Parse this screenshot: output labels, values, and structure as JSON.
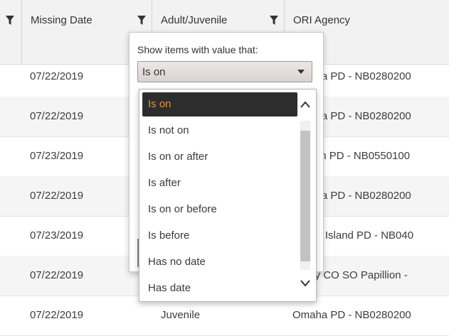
{
  "table": {
    "headers": {
      "missing_date": "Missing Date",
      "adult_juvenile": "Adult/Juvenile",
      "ori_agency": "ORI Agency"
    },
    "rows": [
      {
        "missing_date": "07/22/2019",
        "adult_juvenile": "",
        "ori_agency": "Omaha PD - NB0280200"
      },
      {
        "missing_date": "07/22/2019",
        "adult_juvenile": "",
        "ori_agency": "Omaha PD - NB0280200"
      },
      {
        "missing_date": "07/23/2019",
        "adult_juvenile": "",
        "ori_agency": "Lincoln PD - NB0550100"
      },
      {
        "missing_date": "07/22/2019",
        "adult_juvenile": "",
        "ori_agency": "Omaha PD - NB0280200"
      },
      {
        "missing_date": "07/23/2019",
        "adult_juvenile": "",
        "ori_agency": "Grand Island PD - NB040"
      },
      {
        "missing_date": "07/22/2019",
        "adult_juvenile": "",
        "ori_agency": "Sarpy CO SO Papillion -"
      },
      {
        "missing_date": "07/22/2019",
        "adult_juvenile": "Juvenile",
        "ori_agency": "Omaha PD - NB0280200"
      }
    ]
  },
  "filter": {
    "label": "Show items with value that:",
    "selected_value": "Is on",
    "options": [
      "Is on",
      "Is not on",
      "Is on or after",
      "Is after",
      "Is on or before",
      "Is before",
      "Has no date",
      "Has date"
    ]
  },
  "icons": {
    "filter": "funnel-icon",
    "caret": "caret-down-icon",
    "scroll_up": "chevron-up-icon",
    "scroll_down": "chevron-down-icon"
  },
  "colors": {
    "selected_option_bg": "#2d2d2d",
    "selected_option_text": "#e8912a",
    "header_bg": "#f2f2f2",
    "alt_row_bg": "#f5f5f5"
  }
}
